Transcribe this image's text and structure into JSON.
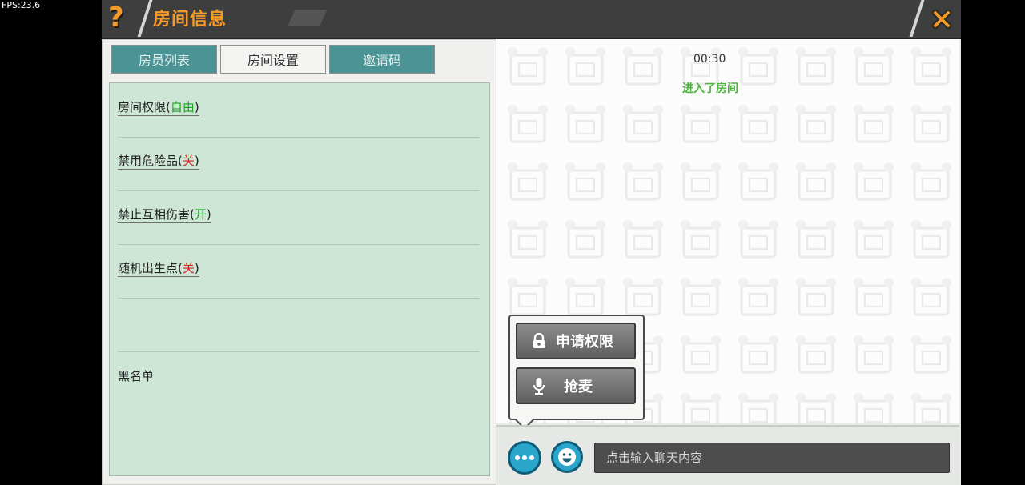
{
  "overlay": {
    "fps": "FPS:23.6"
  },
  "window": {
    "help_glyph": "?",
    "title": "房间信息"
  },
  "tabs": [
    {
      "label": "房员列表",
      "active": false
    },
    {
      "label": "房间设置",
      "active": true
    },
    {
      "label": "邀请码",
      "active": false
    }
  ],
  "settings": [
    {
      "label": "房间权限",
      "open": "(",
      "value": "自由",
      "close": ")"
    },
    {
      "label": "禁用危险品",
      "open": "(",
      "value": "关",
      "close": ")"
    },
    {
      "label": "禁止互相伤害",
      "open": "(",
      "value": "开",
      "close": ")"
    },
    {
      "label": "随机出生点",
      "open": "(",
      "value": "关",
      "close": ")"
    }
  ],
  "blacklist_label": "黑名单",
  "chat": {
    "time": "00:30",
    "system_message": "进入了房间",
    "input_placeholder": "点击输入聊天内容"
  },
  "popup": {
    "request_permission": "申请权限",
    "grab_mic": "抢麦"
  },
  "colors": {
    "accent": "#f49b2b",
    "tab": "#4c9396",
    "panel": "#cde6d6",
    "on_green": "#1ea31e",
    "off_red": "#e02222",
    "round_button": "#2aa5cc"
  },
  "icons": {
    "help": "question-mark-icon",
    "close": "close-x-icon",
    "lock": "lock-icon",
    "mic": "microphone-icon",
    "more": "more-dots-icon",
    "emoji": "smiley-icon"
  }
}
